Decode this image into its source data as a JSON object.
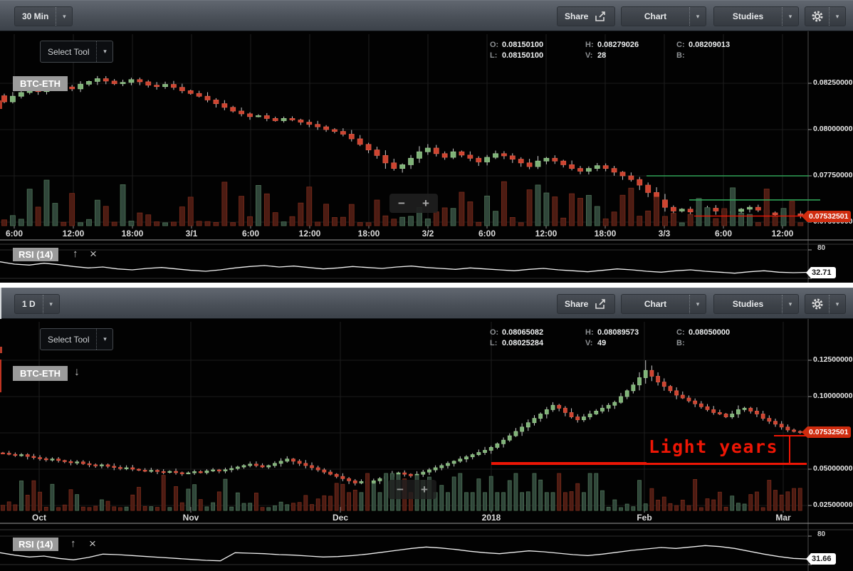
{
  "icons": {
    "chevron": "▾",
    "zoom_out": "−",
    "zoom_in": "+",
    "rsi_move": "↑",
    "rsi_close": "×",
    "symbol_collapse": "↓"
  },
  "colors": {
    "up": "#7eb277",
    "up_stroke": "#99c98f",
    "down": "#cd4430",
    "down_stroke": "#df5743",
    "vol_up": "#30463a",
    "vol_up_stroke": "#4d7356",
    "vol_down": "#4c1c13",
    "vol_down_stroke": "#7c2b1b",
    "wick": "#c9c9c9",
    "tag_red": "#cf2c0f",
    "annotation_red": "#ee1605",
    "trend_green": "#2fa157",
    "rsi_line": "#f0f0f0"
  },
  "panels": [
    {
      "toolbar": {
        "timeframe": "30 Min",
        "share": "Share",
        "chart": "Chart",
        "studies": "Studies"
      },
      "select_tool_label": "Select Tool",
      "symbol": "BTC-ETH",
      "ohlc": {
        "o_label": "O:",
        "o": "0.08150100",
        "l_label": "L:",
        "l": "0.08150100",
        "h_label": "H:",
        "h": "0.08279026",
        "v_label": "V:",
        "v": "28",
        "c_label": "C:",
        "c": "0.08209013",
        "b_label": "B:",
        "b": ""
      },
      "price_axis": {
        "ticks": [
          "0.08250000",
          "0.08000000",
          "0.07750000",
          "0.07500000"
        ],
        "tick_values": [
          0.0825,
          0.08,
          0.0775,
          0.075
        ],
        "last_price_tag": "0.07532501",
        "last_price_value": 0.07532501
      },
      "time_axis": [
        "6:00",
        "12:00",
        "18:00",
        "3/1",
        "6:00",
        "12:00",
        "18:00",
        "3/2",
        "6:00",
        "12:00",
        "18:00",
        "3/3",
        "6:00",
        "12:00"
      ],
      "chart_data": {
        "type": "candlestick",
        "unit": 1e-05,
        "closes": [
          8150,
          8180,
          8200,
          8215,
          8205,
          8225,
          8240,
          8230,
          8220,
          8245,
          8260,
          8275,
          8262,
          8248,
          8255,
          8270,
          8258,
          8240,
          8232,
          8244,
          8228,
          8210,
          8195,
          8180,
          8160,
          8140,
          8120,
          8100,
          8085,
          8070,
          8075,
          8060,
          8048,
          8060,
          8052,
          8040,
          8028,
          8015,
          8000,
          7990,
          7975,
          7950,
          7920,
          7890,
          7860,
          7820,
          7790,
          7810,
          7845,
          7880,
          7900,
          7870,
          7850,
          7880,
          7862,
          7845,
          7825,
          7850,
          7870,
          7858,
          7840,
          7820,
          7800,
          7830,
          7845,
          7830,
          7810,
          7790,
          7775,
          7790,
          7805,
          7790,
          7770,
          7750,
          7730,
          7700,
          7660,
          7620,
          7580,
          7560,
          7570,
          7555,
          7565,
          7575,
          7560,
          7548,
          7558,
          7570,
          7580,
          7565,
          7550,
          7540,
          7555,
          7545,
          7532
        ]
      },
      "rsi": {
        "label": "RSI (14)",
        "upper": "80",
        "lower": "20",
        "value": "32.71",
        "series": [
          55,
          50,
          48,
          52,
          49,
          45,
          42,
          44,
          40,
          38,
          41,
          43,
          40,
          37,
          35,
          38,
          42,
          45,
          47,
          44,
          46,
          43,
          40,
          42,
          45,
          43,
          41,
          44,
          46,
          43,
          41,
          39,
          42,
          40,
          38,
          36,
          39,
          41,
          38,
          36,
          34,
          37,
          40,
          38,
          35,
          33,
          36,
          38,
          35,
          33,
          31,
          34,
          36,
          33,
          32,
          32.7
        ]
      }
    },
    {
      "toolbar": {
        "timeframe": "1 D",
        "share": "Share",
        "chart": "Chart",
        "studies": "Studies"
      },
      "select_tool_label": "Select Tool",
      "symbol": "BTC-ETH",
      "ohlc": {
        "o_label": "O:",
        "o": "0.08065082",
        "l_label": "L:",
        "l": "0.08025284",
        "h_label": "H:",
        "h": "0.08089573",
        "v_label": "V:",
        "v": "49",
        "c_label": "C:",
        "c": "0.08050000",
        "b_label": "B:",
        "b": ""
      },
      "price_axis": {
        "ticks": [
          "0.12500000",
          "0.10000000",
          "0.05000000",
          "0.02500000"
        ],
        "tick_values": [
          0.125,
          0.1,
          0.05,
          0.025
        ],
        "last_price_tag": "0.07532501",
        "last_price_value": 0.07532501
      },
      "time_axis": [
        "Oct",
        "Nov",
        "Dec",
        "2018",
        "Feb",
        "Mar"
      ],
      "chart_data": {
        "type": "candlestick",
        "unit": 0.001,
        "closes": [
          61,
          60.2,
          59.5,
          60,
          58.8,
          58,
          57.2,
          56.5,
          57,
          56,
          55.2,
          54.5,
          55,
          53.8,
          53,
          52.4,
          53,
          52,
          51.2,
          50.5,
          51,
          50,
          49.3,
          48.6,
          49.2,
          48.4,
          47.8,
          48.5,
          47.6,
          47,
          47.5,
          48.3,
          47.6,
          48.8,
          49.5,
          48.8,
          49.6,
          50.5,
          51.5,
          52.5,
          53.5,
          52.5,
          51.5,
          52.5,
          54,
          55.5,
          57,
          55.5,
          54,
          52.5,
          51,
          49.5,
          48,
          46.5,
          45,
          43.5,
          42,
          40.5,
          41.5,
          40.5,
          42,
          43.5,
          45,
          46.5,
          47.5,
          46.5,
          45.5,
          46.5,
          48,
          49.5,
          51,
          52.5,
          54,
          55.5,
          57,
          58.5,
          60,
          61.5,
          63,
          65,
          67.5,
          70,
          73,
          76,
          79,
          82,
          85,
          88,
          91,
          94,
          92,
          89,
          86,
          84,
          86,
          88,
          90,
          92,
          94,
          96,
          100,
          104,
          108,
          113,
          118,
          114,
          110,
          107,
          104,
          101,
          99,
          97,
          95,
          93,
          91,
          89,
          88,
          86,
          88,
          91,
          92,
          90,
          88,
          85,
          83,
          81,
          79,
          77,
          76,
          75.3
        ],
        "wick_overrides": [
          {
            "i": 104,
            "high": 125
          }
        ]
      },
      "annotation": {
        "text": "Light years"
      },
      "rsi": {
        "label": "RSI (14)",
        "upper": "80",
        "lower": "20",
        "value": "31.66",
        "series": [
          45,
          40,
          36,
          38,
          33,
          30,
          35,
          42,
          41,
          39,
          37,
          35,
          33,
          31,
          29,
          28,
          45,
          44,
          43,
          41,
          40,
          38,
          36,
          37,
          39,
          42,
          46,
          50,
          54,
          57,
          55,
          52,
          48,
          45,
          43,
          46,
          49,
          47,
          44,
          41,
          39,
          42,
          46,
          50,
          53,
          56,
          54,
          57,
          60,
          58,
          54,
          48,
          42,
          37,
          33,
          31.7
        ]
      }
    }
  ]
}
